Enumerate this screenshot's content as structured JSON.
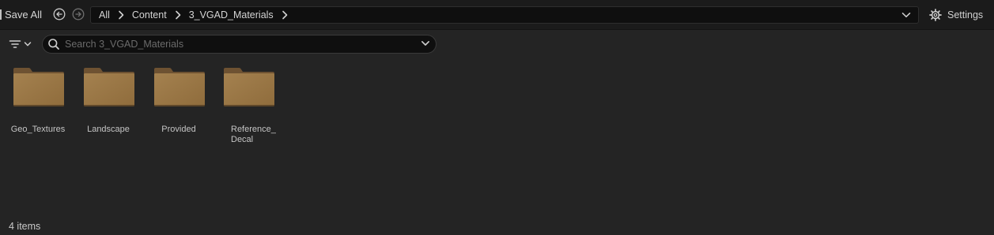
{
  "toolbar": {
    "save_all_label": "Save All",
    "settings_label": "Settings"
  },
  "breadcrumb": {
    "items": [
      "All",
      "Content",
      "3_VGAD_Materials"
    ]
  },
  "search": {
    "placeholder": "Search 3_VGAD_Materials",
    "value": ""
  },
  "folders": [
    {
      "name": "Geo_Textures"
    },
    {
      "name": "Landscape"
    },
    {
      "name": "Provided"
    },
    {
      "name": "Reference_\nDecal"
    }
  ],
  "status": {
    "item_count": "4 items"
  },
  "colors": {
    "background": "#242424",
    "toolbar": "#1b1b1b",
    "field": "#0f0f0f",
    "folder": "#9e7a48"
  }
}
